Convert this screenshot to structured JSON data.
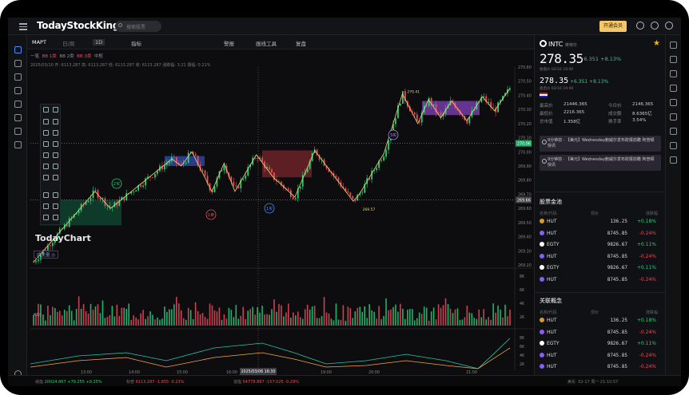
{
  "app": {
    "logo": "TodayStockKing",
    "search_placeholder": "搜索股票",
    "vip_label": "开通会员"
  },
  "toolbar": {
    "symbol": "MAPT",
    "period": "日/周",
    "interval": "1D",
    "indicators": "指标",
    "draw": "画线工具",
    "review": "复盘",
    "alert": "警报"
  },
  "chart": {
    "ind_line": [
      "一笔",
      "BB 1类",
      "BB 2类",
      "BB 3类",
      "中枢"
    ],
    "ohlc": "2025/03/10  开: 6113.287  高: 6113.287  低: 6113.287  收: 6113.287  涨跌幅: 3.21  振幅: 0.21%",
    "watermark": "TodayChart",
    "labels": {
      "b1": "1买",
      "b2": "2买",
      "b3": "3买",
      "s1": "1卖"
    },
    "peak": "270.41",
    "trough": "269.57",
    "price_axis": [
      "270.60",
      "270.50",
      "270.40",
      "270.30",
      "270.20",
      "270.10",
      "270.00",
      "269.90",
      "269.80",
      "269.70",
      "269.60",
      "269.50",
      "269.40",
      "269.30",
      "269.20"
    ],
    "current_price": "270.06",
    "current_price2": "269.66",
    "vol_tag": "成交量 ◎",
    "vol_axis": [
      "8K",
      "6K",
      "4K",
      "2K"
    ],
    "kdj_label": "KDJ",
    "kdj_axis": [
      "8K",
      "6K",
      "4K",
      "2K"
    ],
    "time_axis": [
      "13:00",
      "14:00",
      "15:00",
      "16:00",
      "19:00",
      "20:00",
      "21:00"
    ],
    "cursor_time": "2025/03/06 16:30",
    "colors": {
      "up": "#26d07c",
      "down": "#ef4a5a",
      "zigzag": "#f5d36a",
      "kdj_k": "#26c6a6",
      "kdj_d": "#f5a742"
    }
  },
  "bottombar": {
    "s1_name": "纳指",
    "s1_val": "20024.867",
    "s1_chg": "+79.255",
    "s1_pct": "+0.25%",
    "s2_name": "标普",
    "s2_val": "6113.287",
    "s2_chg": "-1.855",
    "s2_pct": "-0.23%",
    "s3_name": "道指",
    "s3_val": "54778.887",
    "s3_chg": "-157.025",
    "s3_pct": "-0.29%",
    "market": "美东",
    "time": "02-17  周一  21:10:57"
  },
  "quote": {
    "symbol": "INTC",
    "name": "英特尔",
    "price": "278.35",
    "chg": "+6.351",
    "pct": "+8.13%",
    "sub1": "收盘价 02/16  16:00",
    "price2": "278.35",
    "chg2": "+6.351",
    "pct2": "+8.13%",
    "sub2": "盘后价 02/16  19:00",
    "stats": [
      [
        "最高价",
        "21446.365",
        "今日价",
        "2146.365"
      ],
      [
        "最低价",
        "2216.365",
        "成交额",
        "8.6365亿"
      ],
      [
        "总市值",
        "1.358亿",
        "换手率",
        "3.54%"
      ]
    ],
    "news": [
      "9分钟前 · 【美元】Wednesday鲍威尔发布财报前瞻 阿普顿快讯",
      "9分钟前 · 【美元】Wednesday鲍威尔发布财报前瞻 阿普顿快讯"
    ]
  },
  "pool": {
    "title": "股票金池",
    "headers": [
      "名称/代码",
      "现价",
      "涨跌幅"
    ],
    "rows": [
      [
        "HUT",
        "136.25",
        "+0.18%"
      ],
      [
        "HUT",
        "8745.85",
        "-0.24%"
      ],
      [
        "EGTY",
        "9826.67",
        "+0.11%"
      ],
      [
        "HUT",
        "8745.85",
        "-0.24%"
      ],
      [
        "EGTY",
        "9826.67",
        "+0.11%"
      ],
      [
        "HUT",
        "8745.85",
        "-0.24%"
      ]
    ]
  },
  "concept": {
    "title": "关联概念",
    "headers": [
      "名称/代码",
      "现价",
      "涨跌幅"
    ],
    "rows": [
      [
        "HUT",
        "136.25",
        "+0.18%"
      ],
      [
        "HUT",
        "8745.85",
        "-0.24%"
      ],
      [
        "EGTY",
        "9826.67",
        "+0.11%"
      ],
      [
        "HUT",
        "8745.85",
        "-0.24%"
      ],
      [
        "HUT",
        "8745.85",
        "-0.24%"
      ]
    ]
  }
}
